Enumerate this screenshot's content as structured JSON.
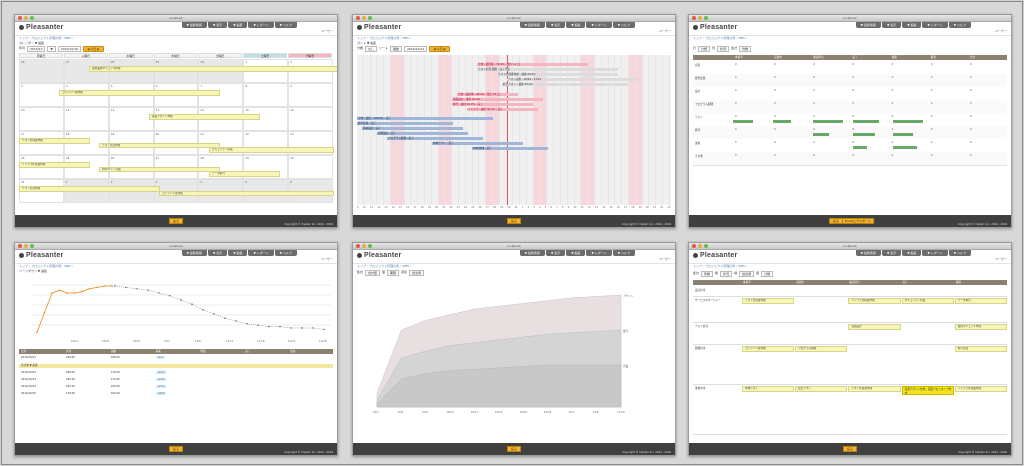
{
  "app": {
    "window_title": "localhost",
    "logo": "Pleasanter",
    "nav": [
      "▼ 最新情報",
      "▼ 表示",
      "▼ 編集",
      "▼ レポート",
      "▼ ヘルプ"
    ],
    "user_label": "ユーザー",
    "breadcrumb": "トップ › プロジェクト管理の例 › WBS ›",
    "footer_button": "戻る",
    "footer_copyright": "Copyright © Implem Inc. 2014 - 2016",
    "footer_wide_button": "Excelエクスポート",
    "accent_color": "#f2b233",
    "footer_color": "#3f3f3f"
  },
  "calendar": {
    "tabs": "カレンダー ▼ 編集",
    "controls": [
      "年月",
      "2016/10",
      "▼",
      "2016/10/10"
    ],
    "weekdays": [
      "月曜日",
      "火曜日",
      "水曜日",
      "木曜日",
      "金曜日",
      "土曜日",
      "日曜日"
    ],
    "weeks": [
      [
        "26",
        "27",
        "28",
        "29",
        "30",
        "1",
        "2"
      ],
      [
        "3",
        "4",
        "5",
        "6",
        "7",
        "8",
        "9"
      ],
      [
        "10",
        "11",
        "12",
        "13",
        "14",
        "15",
        "16"
      ],
      [
        "17",
        "18",
        "19",
        "20",
        "21",
        "22",
        "23"
      ],
      [
        "24",
        "25",
        "26",
        "27",
        "28",
        "29",
        "30"
      ],
      [
        "31",
        "1",
        "2",
        "3",
        "4",
        "5",
        "6"
      ]
    ],
    "events": [
      "運用業務マニュアル作成",
      "コンテンツ案作成",
      "画面デザイン作成",
      "テスト仕様書作成",
      "インフラ仕様書作成",
      "データ移行",
      "テスト計画作成",
      "セキュリティ対策",
      "Webサイト公開"
    ]
  },
  "gantt": {
    "tabs": "ガント ▼ 編集",
    "controls": [
      "分類",
      "なし",
      "ソート",
      "開始",
      "2016/10/11"
    ],
    "bars": [
      {
        "label": "全体 - 進捗率 - 70.0% - 残り 12 日",
        "color": "red"
      },
      {
        "label": "テスト計画 開始 - 完了予定",
        "color": "grey"
      },
      {
        "label": "テスト仕様書作成 - 進捗 60.0%",
        "color": "grey"
      },
      {
        "label": "テスト実施 - 10/24 - 11/04",
        "color": "grey"
      },
      {
        "label": "結合テスト - 進捗 45.0%",
        "color": "grey"
      },
      {
        "label": "全体 - 進捗率 - 48.2% - 残り 18 日",
        "color": "red"
      },
      {
        "label": "画面設計 - 進捗 50.0%",
        "color": "red"
      },
      {
        "label": "移行 - 進捗 40.0% - 完了",
        "color": "red"
      },
      {
        "label": "インフラ - 進捗 30.0% - 完了",
        "color": "red"
      },
      {
        "label": "全体 - 進捗 - 100.0% - 完了",
        "color": "blue"
      },
      {
        "label": "要件定義 - 完了",
        "color": "blue"
      },
      {
        "label": "基本設計 - 完了",
        "color": "blue"
      },
      {
        "label": "詳細設計 - 完了",
        "color": "blue"
      },
      {
        "label": "プログラム開発 - 完了",
        "color": "blue"
      },
      {
        "label": "単体テスト - 完了",
        "color": "blue"
      },
      {
        "label": "WBS作成 - 完了",
        "color": "blue"
      }
    ],
    "axis": [
      "9",
      "10",
      "11",
      "12",
      "13",
      "14",
      "15",
      "16",
      "17",
      "18",
      "19",
      "20",
      "21",
      "22",
      "23",
      "24",
      "25",
      "26",
      "27",
      "28",
      "29",
      "30",
      "31",
      "1",
      "2",
      "3",
      "4",
      "5",
      "6",
      "7",
      "8",
      "9",
      "10",
      "11",
      "12",
      "13",
      "14",
      "15",
      "16",
      "17",
      "18",
      "19",
      "20",
      "21",
      "22",
      "23"
    ]
  },
  "crosstab": {
    "controls": [
      "行",
      "分類",
      "列",
      "状況",
      "集計",
      "件数"
    ],
    "columns": [
      "未着手",
      "実施中",
      "確認待ち",
      "完了",
      "保留",
      "取消",
      "合計"
    ],
    "rows": [
      {
        "label": "企画",
        "vals": [
          "0",
          "0",
          "0",
          "0",
          "0",
          "0",
          "0"
        ]
      },
      {
        "label": "要件定義",
        "vals": [
          "0",
          "0",
          "0",
          "0",
          "0",
          "0",
          "0"
        ]
      },
      {
        "label": "設計",
        "vals": [
          "0",
          "0",
          "0",
          "0",
          "0",
          "0",
          "0"
        ]
      },
      {
        "label": "プログラム開発",
        "vals": [
          "0",
          "0",
          "0",
          "0",
          "0",
          "0",
          "0"
        ]
      },
      {
        "label": "テスト",
        "vals": [
          "0",
          "0",
          "0",
          "0",
          "0",
          "0",
          "0"
        ]
      },
      {
        "label": "移行",
        "vals": [
          "0",
          "0",
          "0",
          "0",
          "0",
          "0",
          "0"
        ]
      },
      {
        "label": "運用",
        "vals": [
          "0",
          "0",
          "0",
          "0",
          "0",
          "0",
          "0"
        ]
      },
      {
        "label": "その他",
        "vals": [
          "0",
          "0",
          "0",
          "0",
          "0",
          "0",
          "0"
        ]
      }
    ]
  },
  "burndown": {
    "tabs": "バーンダウン ▼ 編集",
    "headers": [
      "日付",
      "計画",
      "実績",
      "差異",
      "増加",
      "完了",
      "追加"
    ],
    "rows": [
      [
        "2016/10/21",
        "190.00",
        "186.00",
        "-4.0"
      ],
      [
        "2016/10/22",
        "188.00",
        "176.00",
        "-12.0"
      ],
      [
        "2016/10/23",
        "185.00",
        "172.00",
        "-13.0"
      ],
      [
        "2016/10/24",
        "182.00",
        "165.00",
        "-17.0"
      ],
      [
        "2016/10/25",
        "178.00",
        "162.00",
        "-16.0"
      ]
    ],
    "highlight": "合計値 ▼ 差異",
    "x_ticks": [
      "10/11",
      "10/21",
      "10/27",
      "11/1",
      "11/6",
      "11/11",
      "11/16",
      "11/21",
      "11/26"
    ],
    "chart_data": {
      "type": "line",
      "series": [
        {
          "values": [
            2,
            16,
            30,
            32,
            30,
            30,
            31,
            33,
            34,
            35,
            35
          ]
        },
        {
          "values": [
            35,
            34,
            33,
            32,
            30,
            28,
            25,
            22,
            18,
            15,
            12,
            10,
            8,
            7,
            6,
            6,
            5,
            5,
            5,
            4
          ]
        }
      ]
    }
  },
  "timeseries": {
    "controls": [
      "集計",
      "合計値",
      "値",
      "期限",
      "項目",
      "担当者"
    ],
    "chart_data": {
      "type": "area",
      "series": [
        {
          "name": "アサイン",
          "values": [
            10,
            55,
            62,
            66,
            70,
            72,
            74,
            76,
            78,
            79,
            80
          ]
        },
        {
          "name": "保守",
          "values": [
            5,
            35,
            40,
            44,
            46,
            48,
            50,
            52,
            53,
            54,
            55
          ]
        },
        {
          "name": "営業",
          "values": [
            2,
            20,
            24,
            26,
            27,
            28,
            29,
            30,
            30,
            30,
            30
          ]
        }
      ],
      "x": [
        "10/1",
        "10/5",
        "10/9",
        "10/13",
        "10/17",
        "10/21",
        "10/25",
        "10/29",
        "11/2",
        "11/6",
        "11/10"
      ]
    }
  },
  "kamban": {
    "controls": [
      "集計",
      "件数",
      "縦",
      "状況",
      "横",
      "担当者",
      "値",
      "分類"
    ],
    "columns": [
      "未着手",
      "実施中",
      "確認待ち",
      "完了",
      "保留"
    ],
    "rows": [
      "設計担当",
      "サービスマネージャー",
      "テスト担当",
      "開発担当",
      "運用担当"
    ],
    "cards": [
      "テスト仕様書作成",
      "インフラ仕様書作成",
      "セキュリティ対策",
      "データ移行",
      "画面設計",
      "運用マニュアル作成",
      "コンテンツ案作成",
      "プログラム開発",
      "移行計画",
      "単体テスト",
      "結合テスト"
    ],
    "highlight_card": "画面デザイン作成 - 画面プロトタイプ作成"
  }
}
